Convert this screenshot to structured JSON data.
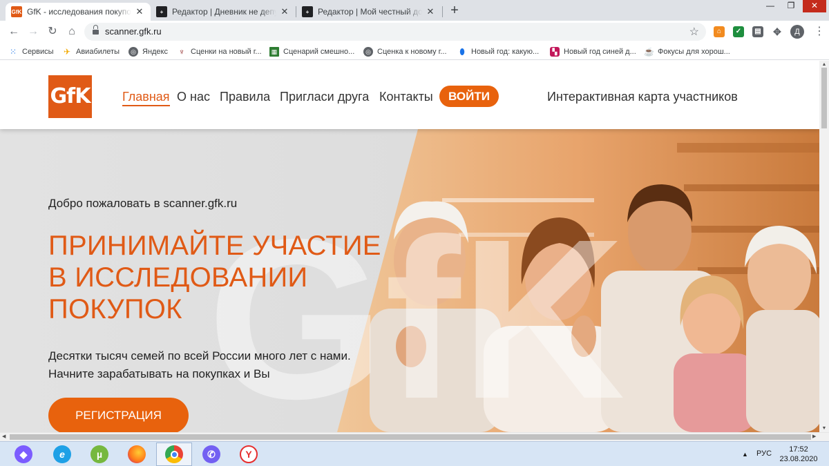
{
  "browser": {
    "tabs": [
      {
        "title": "GfK - исследования покупок домохозяйств",
        "favicon": "GfK"
      },
      {
        "title": "Редактор | Дневник не депутата",
        "favicon": "plus-box"
      },
      {
        "title": "Редактор | Мой честный дополнительный доход",
        "favicon": "plus-box"
      }
    ],
    "close_glyph": "✕",
    "new_tab_glyph": "+",
    "window_controls": {
      "minimize": "—",
      "maximize": "❐",
      "close": "✕"
    },
    "url": "scanner.gfk.ru",
    "avatar_letter": "Д",
    "bookmarks": [
      {
        "label": "Сервисы",
        "icon": "apps-grid-icon"
      },
      {
        "label": "Авиабилеты",
        "icon": "plane-icon"
      },
      {
        "label": "Яндекс",
        "icon": "globe-icon"
      },
      {
        "label": "Сценки на новый г...",
        "icon": "wine-icon"
      },
      {
        "label": "Сценарий смешно...",
        "icon": "qr-icon"
      },
      {
        "label": "Сценка к новому г...",
        "icon": "globe-icon"
      },
      {
        "label": "Новый год: какую...",
        "icon": "pin-icon"
      },
      {
        "label": "Новый год синей д...",
        "icon": "checkered-icon"
      },
      {
        "label": "Фокусы для хорош...",
        "icon": "cup-icon"
      }
    ],
    "colors": {
      "tabstrip": "#dee1e6",
      "accent": "#e05a16"
    }
  },
  "site": {
    "logo_text": "GfK",
    "nav": [
      "Главная",
      "О нас",
      "Правила",
      "Пригласи друга",
      "Контакты"
    ],
    "login_label": "ВОЙТИ",
    "map_link": "Интерактивная карта участников",
    "hero": {
      "watermark": "GfK",
      "welcome": "Добро пожаловать в scanner.gfk.ru",
      "headline_lines": [
        "ПРИНИМАЙТЕ УЧАСТИЕ",
        "В ИССЛЕДОВАНИИ",
        "ПОКУПОК"
      ],
      "sub_lines": [
        "Десятки тысяч семей по всей России много лет с нами.",
        "Начните зарабатывать на покупках и Вы"
      ],
      "register_label": "РЕГИСТРАЦИЯ"
    }
  },
  "taskbar": {
    "apps": [
      {
        "name": "alice-icon",
        "color": "#7b5cff"
      },
      {
        "name": "internet-explorer-icon",
        "color": "#1ea0e6"
      },
      {
        "name": "utorrent-icon",
        "color": "#76b83f"
      },
      {
        "name": "firefox-icon",
        "color": "#ff7a1a"
      },
      {
        "name": "chrome-icon",
        "color": "#34a853"
      },
      {
        "name": "viber-icon",
        "color": "#7360f2"
      },
      {
        "name": "yandex-browser-icon",
        "color": "#e62e2e"
      }
    ],
    "tray_arrow": "▲",
    "language": "РУС",
    "time": "17:52",
    "date": "23.08.2020"
  }
}
